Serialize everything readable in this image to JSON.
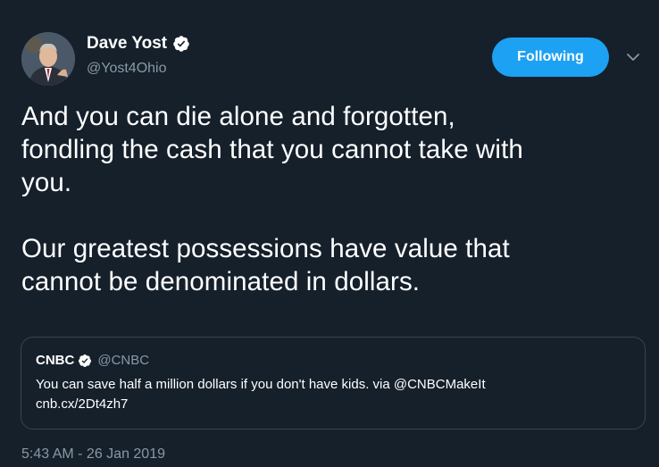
{
  "author": {
    "display_name": "Dave Yost",
    "handle": "@Yost4Ohio",
    "verified": true
  },
  "follow_button": {
    "label": "Following",
    "color": "#1da1f2"
  },
  "tweet": {
    "text": "And you can die alone and forgotten,\nfondling the cash that you cannot take with\nyou.\n\nOur greatest possessions have value that\ncannot be denominated in dollars."
  },
  "quoted_tweet": {
    "display_name": "CNBC",
    "handle": "@CNBC",
    "verified": true,
    "text": "You can save half a million dollars if you don't have kids. via @CNBCMakeIt\ncnb.cx/2Dt4zh7"
  },
  "timestamp": "5:43 AM - 26 Jan 2019",
  "icons": {
    "verified": "verified-badge-icon",
    "menu": "chevron-down-icon"
  },
  "colors": {
    "background": "#15202b",
    "text_secondary": "#8899a6",
    "accent": "#1da1f2",
    "border": "#38444d"
  }
}
